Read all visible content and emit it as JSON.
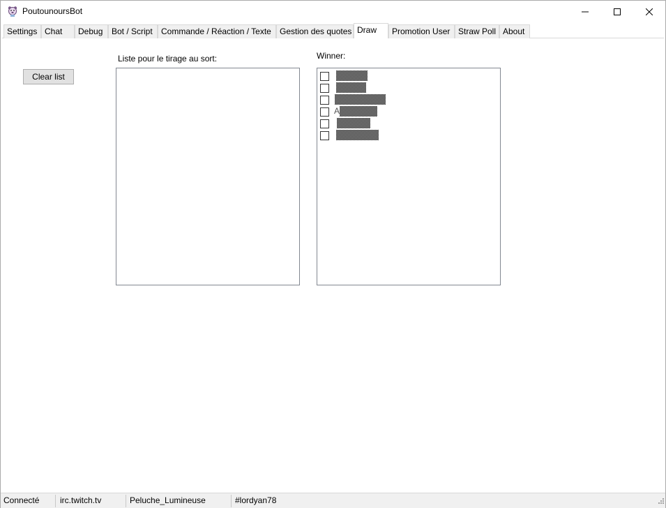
{
  "window": {
    "title": "PoutounoursBot",
    "icon": "bear-app-icon",
    "controls": {
      "minimize": "—",
      "maximize": "☐",
      "close": "✕"
    }
  },
  "tabs": [
    {
      "label": "Settings"
    },
    {
      "label": "Chat"
    },
    {
      "label": "Debug"
    },
    {
      "label": "Bot / Script"
    },
    {
      "label": "Commande / Réaction / Texte"
    },
    {
      "label": "Gestion des quotes"
    },
    {
      "label": "Draw",
      "active": true
    },
    {
      "label": "Promotion User"
    },
    {
      "label": "Straw Poll"
    },
    {
      "label": "About"
    }
  ],
  "draw": {
    "clear_button": "Clear list",
    "list_label": "Liste pour le tirage au sort:",
    "winner_label": "Winner:",
    "winners": [
      {
        "checked": false,
        "prefix": ""
      },
      {
        "checked": false,
        "prefix": ""
      },
      {
        "checked": false,
        "prefix": ""
      },
      {
        "checked": false,
        "prefix": "A"
      },
      {
        "checked": false,
        "prefix": ""
      },
      {
        "checked": false,
        "prefix": ""
      }
    ]
  },
  "status": {
    "connection": "Connecté",
    "server": "irc.twitch.tv",
    "user": "Peluche_Lumineuse",
    "channel": "#lordyan78"
  }
}
